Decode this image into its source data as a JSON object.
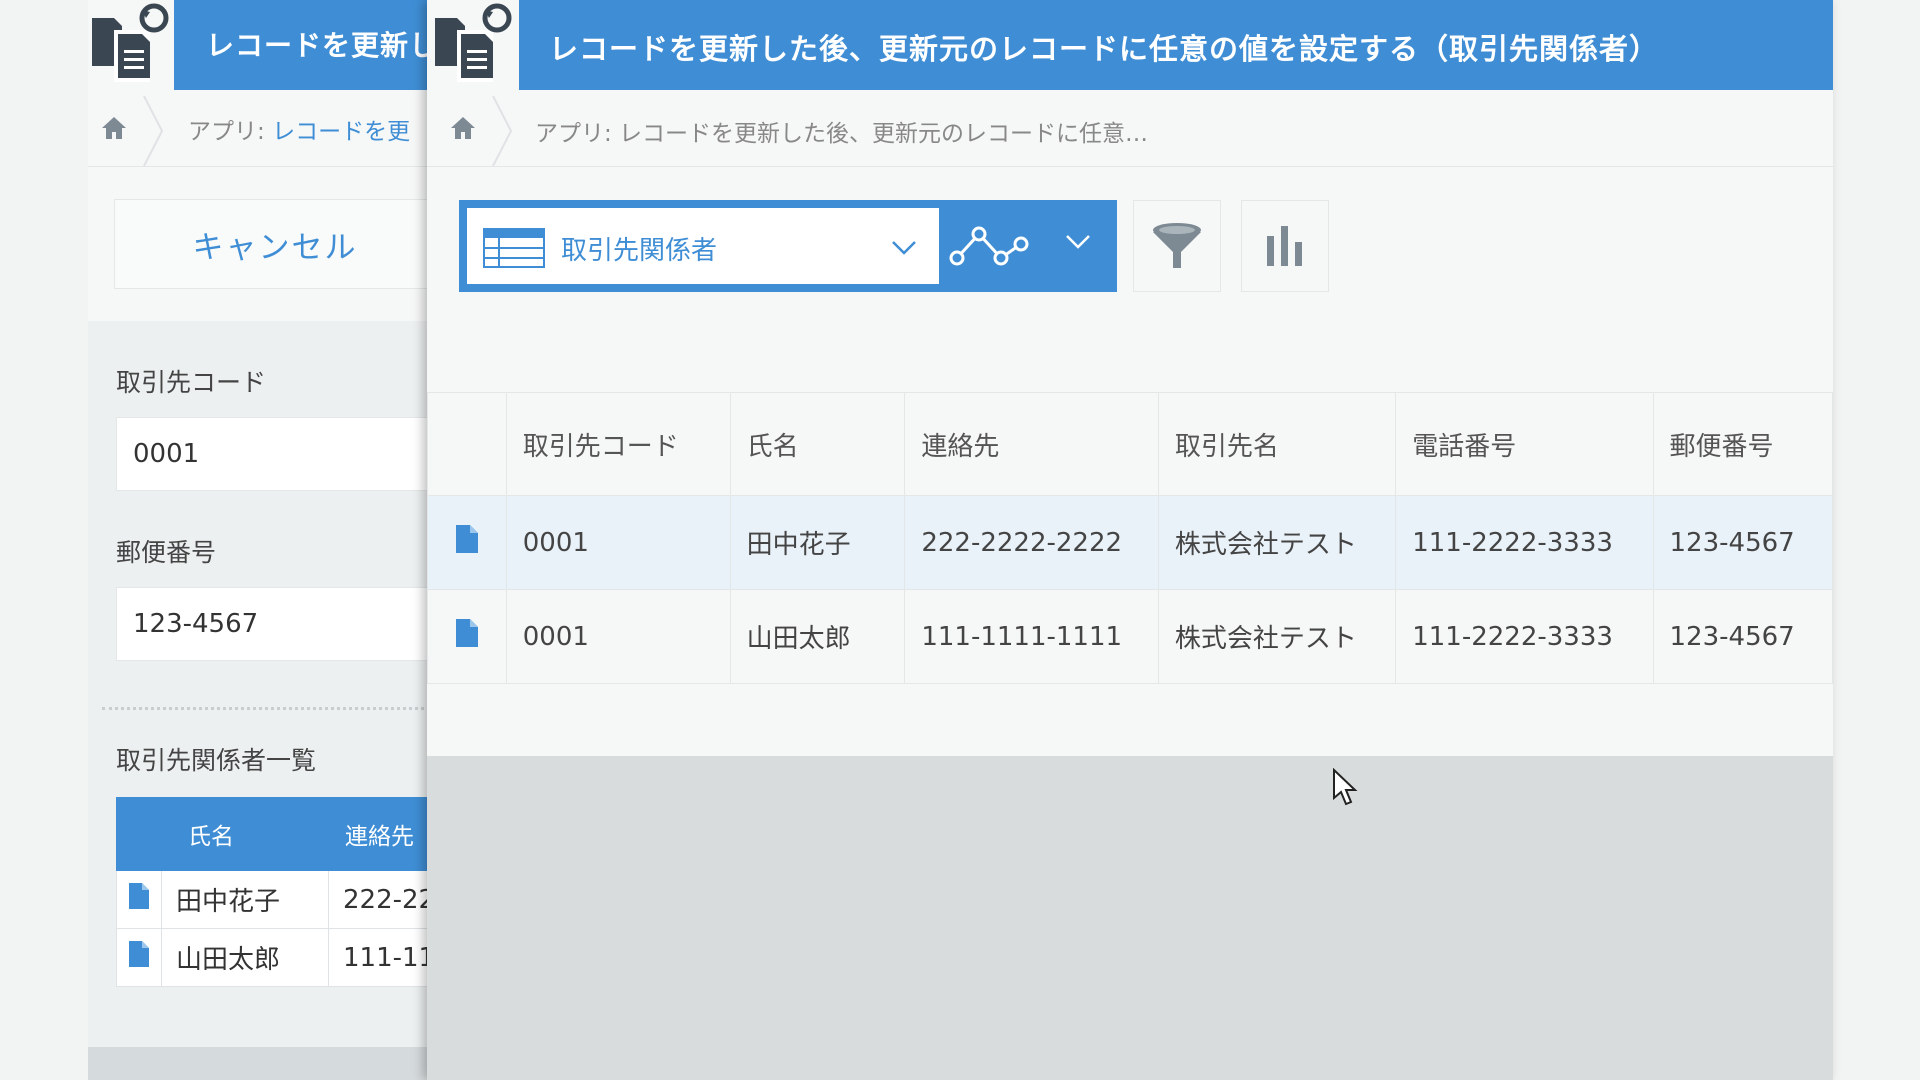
{
  "back_window": {
    "title": "レコードを更新し",
    "breadcrumb": {
      "prefix": "アプリ: ",
      "link": "レコードを更"
    },
    "cancel_label": "キャンセル",
    "fields": [
      {
        "label": "取引先コード",
        "value": "0001"
      },
      {
        "label": "郵便番号",
        "value": "123-4567"
      }
    ],
    "subtable": {
      "title": "取引先関係者一覧",
      "headers": [
        "氏名",
        "連絡先"
      ],
      "rows": [
        {
          "name": "田中花子",
          "contact": "222-22"
        },
        {
          "name": "山田太郎",
          "contact": "111-11"
        }
      ]
    }
  },
  "front_window": {
    "title": "レコードを更新した後、更新元のレコードに任意の値を設定する（取引先関係者）",
    "breadcrumb": "アプリ: レコードを更新した後、更新元のレコードに任意…",
    "view_selector": {
      "selected": "取引先関係者"
    },
    "table": {
      "headers": [
        "取引先コード",
        "氏名",
        "連絡先",
        "取引先名",
        "電話番号",
        "郵便番号"
      ],
      "rows": [
        {
          "code": "0001",
          "name": "田中花子",
          "contact": "222-2222-2222",
          "company": "株式会社テスト",
          "phone": "111-2222-3333",
          "zip": "123-4567"
        },
        {
          "code": "0001",
          "name": "山田太郎",
          "contact": "111-1111-1111",
          "company": "株式会社テスト",
          "phone": "111-2222-3333",
          "zip": "123-4567"
        }
      ]
    }
  },
  "icons": {
    "app": "app-document-refresh-icon",
    "home": "home-icon",
    "record": "document-icon",
    "view_table": "table-icon",
    "graph": "graph-icon",
    "filter": "filter-icon",
    "chart": "bar-chart-icon",
    "cursor": "mouse-cursor"
  },
  "colors": {
    "accent": "#3f8ed5",
    "header_bg": "#3f8ed5",
    "row_highlight": "#eaf2f9"
  }
}
